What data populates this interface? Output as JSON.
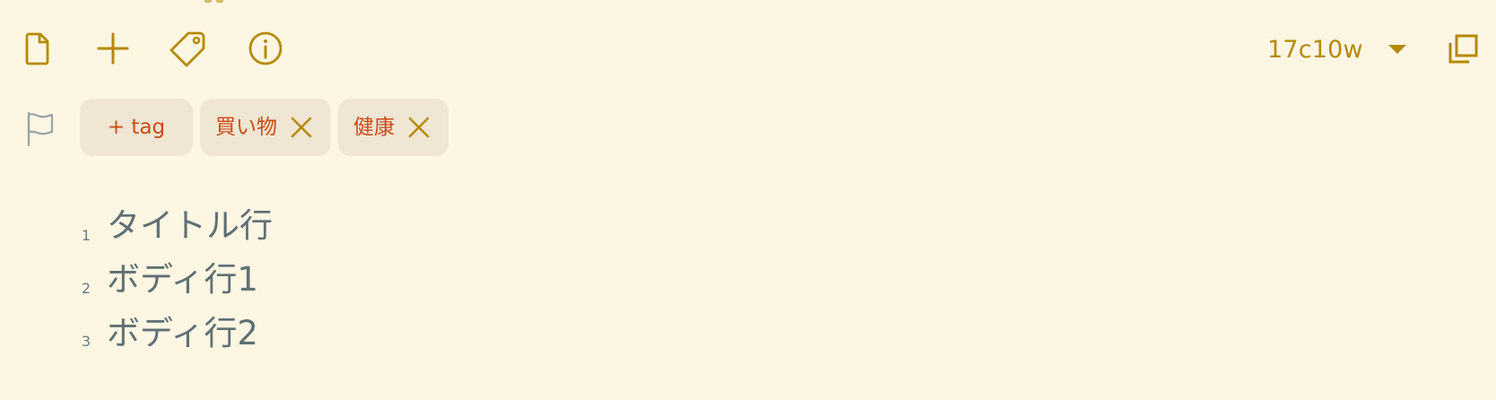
{
  "toolbar": {
    "icons": [
      {
        "name": "document-icon"
      },
      {
        "name": "plus-icon"
      },
      {
        "name": "tag-icon"
      },
      {
        "name": "info-icon"
      },
      {
        "name": "expand-icon"
      }
    ],
    "version_label": "17c10w"
  },
  "tags": {
    "add_label": "+ tag",
    "items": [
      {
        "label": "買い物"
      },
      {
        "label": "健康"
      }
    ]
  },
  "editor": {
    "lines": [
      {
        "number": "1",
        "text": "タイトル行"
      },
      {
        "number": "2",
        "text": "ボディ行1"
      },
      {
        "number": "3",
        "text": "ボディ行2"
      }
    ]
  },
  "colors": {
    "background": "#fdf6e3",
    "accent": "#b58900",
    "tag_text": "#cb4b16",
    "chip_background": "#efe6d4",
    "text": "#5f6f73"
  }
}
